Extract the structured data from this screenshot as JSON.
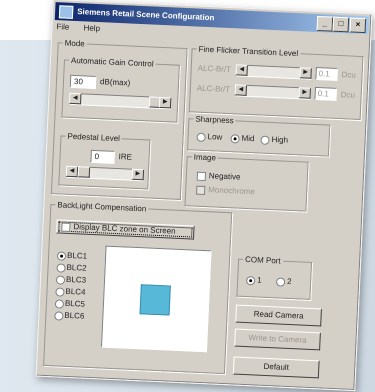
{
  "window": {
    "title": "Siemens Retail Scene Configuration"
  },
  "menu": [
    "File",
    "Help"
  ],
  "mode": {
    "legend": "Mode",
    "agc": {
      "legend": "Automatic Gain Control",
      "value": "30",
      "unit": "dB(max)"
    },
    "pedestal": {
      "legend": "Pedestal Level",
      "value": "0",
      "unit": "IRE"
    }
  },
  "flicker": {
    "legend": "Fine Flicker Transition Level",
    "row1_label": "ALC-Br/T",
    "row1_value": "0.1",
    "row1_unit": "Dcu",
    "row2_label": "ALC-Br/T",
    "row2_value": "0.1",
    "row2_unit": "Dcu"
  },
  "sharpness": {
    "legend": "Sharpness",
    "options": [
      "Low",
      "Mid",
      "High"
    ],
    "selected": 1
  },
  "image": {
    "legend": "Image",
    "negative": "Negative",
    "monochrome": "Monochrome"
  },
  "blc": {
    "legend": "BackLight Compensation",
    "display_zone": "Display BLC zone on Screen",
    "zones": [
      "BLC1",
      "BLC2",
      "BLC3",
      "BLC4",
      "BLC5",
      "BLC6"
    ],
    "selected": 0
  },
  "com_port": {
    "legend": "COM Port",
    "options": [
      "1",
      "2"
    ],
    "selected": 0
  },
  "buttons": {
    "read_camera": "Read Camera",
    "write_camera": "Write to Camera",
    "default": "Default"
  },
  "colors": {
    "zone_fill": "#58b8d8",
    "title_start": "#0a246a",
    "title_end": "#a6caf0"
  }
}
